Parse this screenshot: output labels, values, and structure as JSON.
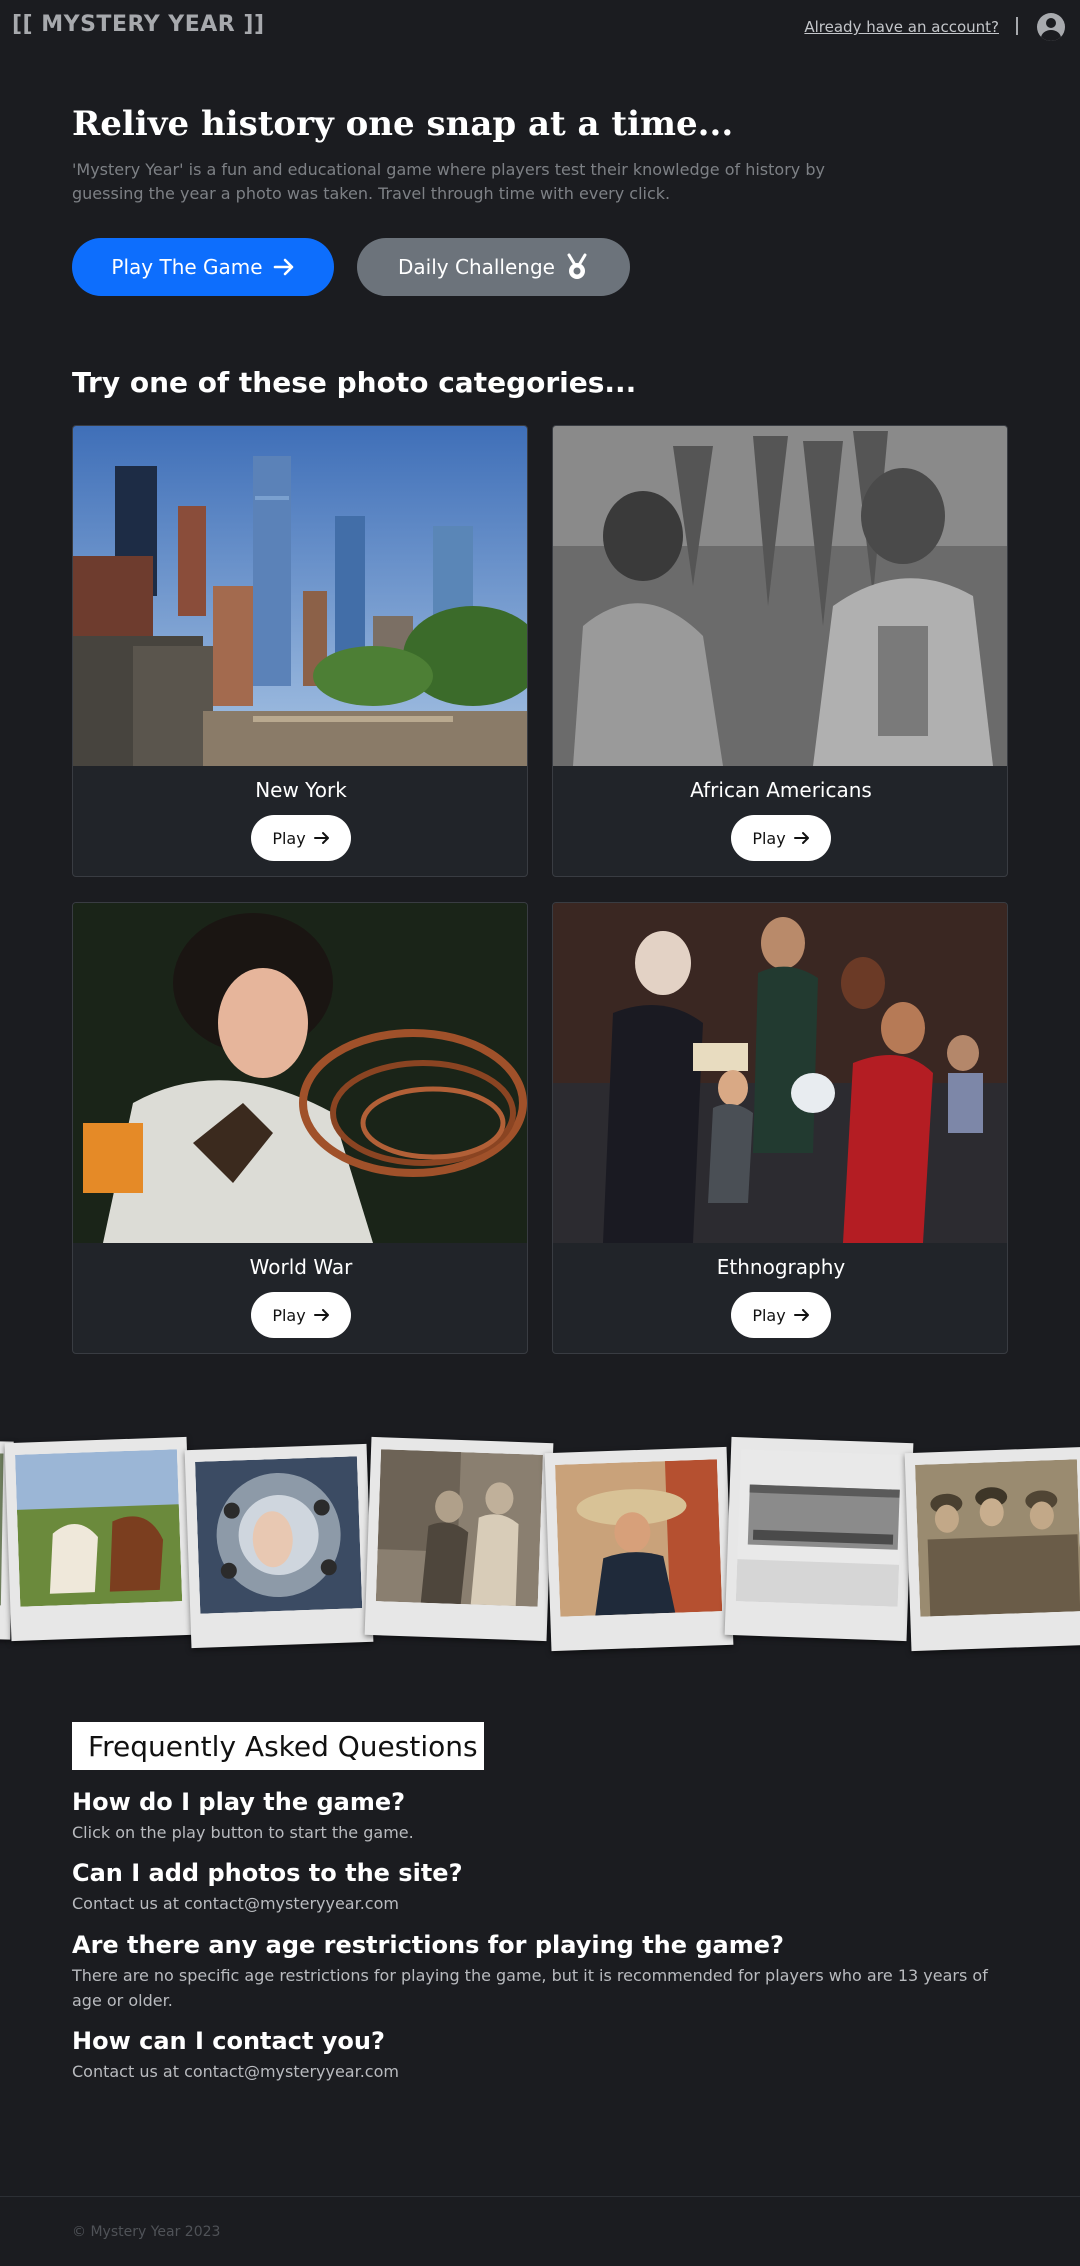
{
  "header": {
    "logo": "[[ MYSTERY YEAR ]]",
    "login_link": "Already have an account?",
    "profile_icon": "user-circle-icon"
  },
  "hero": {
    "title": "Relive history one snap at a time...",
    "subtitle": "'Mystery Year' is a fun and educational game where players test their knowledge of history by guessing the year a photo was taken. Travel through time with every click.",
    "play_button": "Play The Game",
    "play_icon": "arrow-right-icon",
    "daily_button": "Daily Challenge",
    "daily_icon": "medal-icon",
    "colors": {
      "primary": "#0d6efd",
      "secondary": "#6c737b"
    }
  },
  "categories": {
    "heading": "Try one of these photo categories...",
    "items": [
      {
        "name": "New York",
        "play_label": "Play"
      },
      {
        "name": "African Americans",
        "play_label": "Play"
      },
      {
        "name": "World War",
        "play_label": "Play"
      },
      {
        "name": "Ethnography",
        "play_label": "Play"
      }
    ]
  },
  "faq": {
    "title": "Frequently Asked Questions",
    "items": [
      {
        "q": "How do I play the game?",
        "a": "Click on the play button to start the game."
      },
      {
        "q": "Can I add photos to the site?",
        "a": "Contact us at contact@mysteryyear.com"
      },
      {
        "q": "Are there any age restrictions for playing the game?",
        "a": "There are no specific age restrictions for playing the game, but it is recommended for players who are 13 years of age or older."
      },
      {
        "q": "How can I contact you?",
        "a": "Contact us at contact@mysteryyear.com"
      }
    ]
  },
  "footer": {
    "copyright": "© Mystery Year 2023"
  }
}
